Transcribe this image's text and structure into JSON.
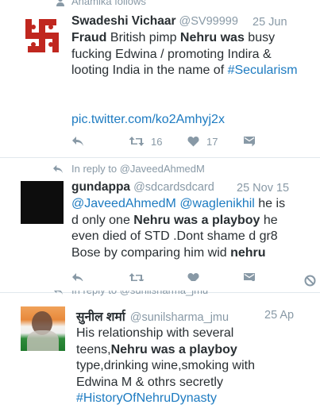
{
  "tweets": [
    {
      "context": "Anamika follows",
      "name": "Swadeshi Vichaar",
      "handle": "@SV99999",
      "time": "25 Jun",
      "avatar_icon": "swastika-logo",
      "text": {
        "s1": "Fraud",
        "s2": " British pimp ",
        "s3": "Nehru was",
        "s4": " busy fucking Edwina / promoting Indira & looting India in the name of ",
        "s5": "#Secularism"
      },
      "link": "pic.twitter.com/ko2Amhyj2x",
      "retweets": "16",
      "likes": "17"
    },
    {
      "context": "In reply to @JaveedAhmedM",
      "name": "gundappa",
      "handle": "@sdcardsdcard",
      "time": "25 Nov 15",
      "text": {
        "s1": "@JaveedAhmedM",
        "s2": " ",
        "s3": "@waglenikhil",
        "s4": " he is d only one ",
        "s5": "Nehru was a playboy",
        "s6": " he even died of STD .Dont shame d gr8 Bose by comparing him wid ",
        "s7": "nehru"
      }
    },
    {
      "context": "In reply to @sunilsharma_jmu",
      "name": "सुनील शर्मा",
      "handle": "@sunilsharma_jmu",
      "time": "25 Ap",
      "text": {
        "s1": "His relationship with several teens,",
        "s2": "Nehru was a playboy",
        "s3": " type,drinking wine,smoking with Edwina M & othrs secretly ",
        "s4": "#HistoryOfNehruDynasty"
      }
    }
  ],
  "colors": {
    "link": "#1d7bc1",
    "muted": "#8899a6",
    "logo_red": "#c0271f"
  }
}
